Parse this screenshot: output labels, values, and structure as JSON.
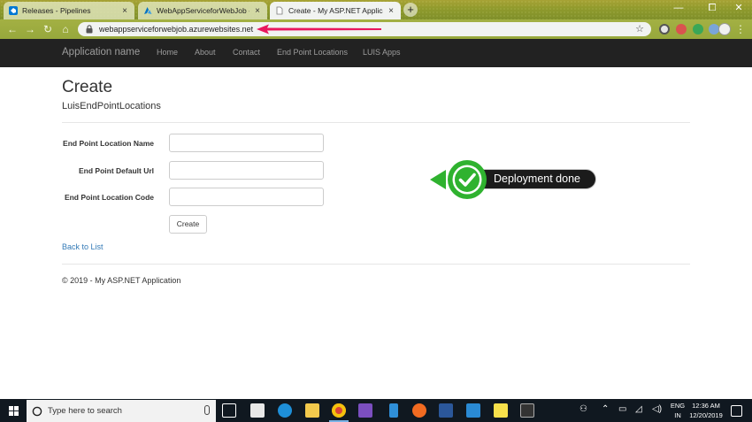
{
  "browser": {
    "tabs": [
      {
        "title": "Releases - Pipelines",
        "close": "×"
      },
      {
        "title": "WebAppServiceforWebJob - Mic",
        "close": "×"
      },
      {
        "title": "Create - My ASP.NET Application",
        "close": "×"
      }
    ],
    "new_tab": "+",
    "window_controls": {
      "minimize": "—",
      "maximize": "⧠",
      "close": "✕"
    },
    "nav": {
      "back": "←",
      "forward": "→",
      "reload": "↻",
      "home": "⌂"
    },
    "url": "webappserviceforwebjob.azurewebsites.net",
    "star": "☆",
    "annotation_color": "#e8175d"
  },
  "site": {
    "brand": "Application name",
    "nav_links": [
      "Home",
      "About",
      "Contact",
      "End Point Locations",
      "LUIS Apps"
    ]
  },
  "page": {
    "title": "Create",
    "subtitle": "LuisEndPointLocations",
    "fields": [
      {
        "label": "End Point Location Name",
        "value": ""
      },
      {
        "label": "End Point Default Url",
        "value": ""
      },
      {
        "label": "End Point Location Code",
        "value": ""
      }
    ],
    "submit": "Create",
    "back_link": "Back to List",
    "footer": "© 2019 - My ASP.NET Application"
  },
  "callout": {
    "text": "Deployment done",
    "accent": "#2fb22f"
  },
  "taskbar": {
    "search_placeholder": "Type here to search",
    "language_line1": "ENG",
    "language_line2": "IN",
    "time": "12:36 AM",
    "date": "12/20/2019"
  }
}
